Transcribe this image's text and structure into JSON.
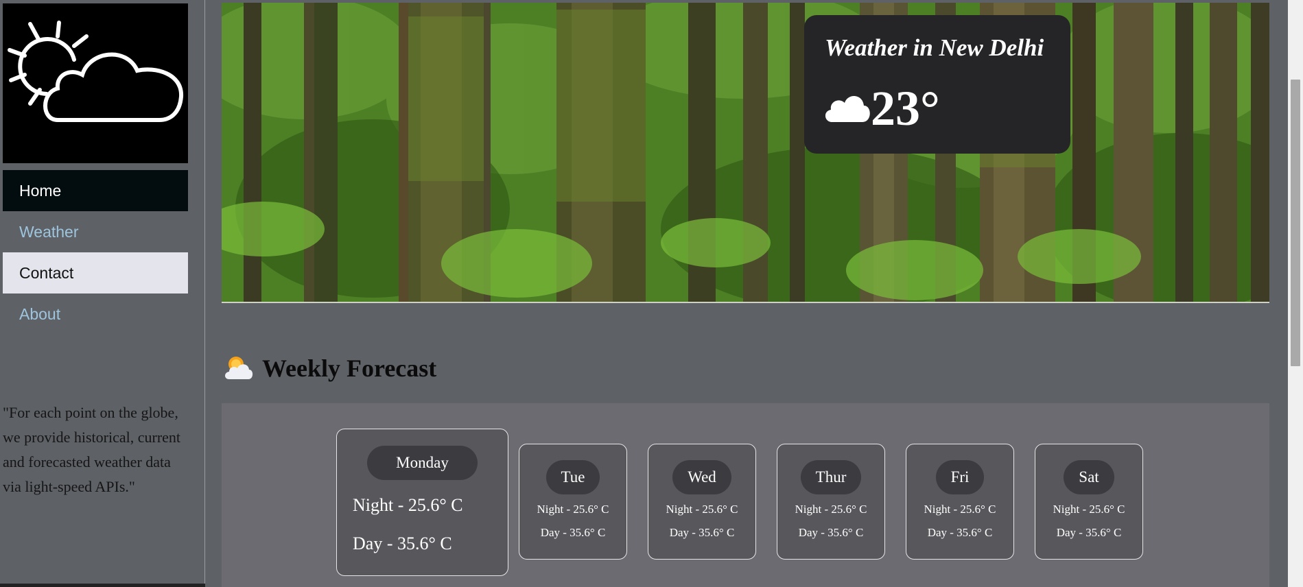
{
  "sidebar": {
    "logo_icon": "partly-cloudy-outline-icon",
    "nav": [
      {
        "label": "Home",
        "state": "active"
      },
      {
        "label": "Weather",
        "state": "link"
      },
      {
        "label": "Contact",
        "state": "highlighted"
      },
      {
        "label": "About",
        "state": "link"
      }
    ],
    "quote": "\"For each point on the globe, we provide historical, current and forecasted weather data via light-speed APIs.\""
  },
  "hero": {
    "background": "forest-photo",
    "card": {
      "title": "Weather in New Delhi",
      "icon": "cloud-icon",
      "temperature": "23°"
    }
  },
  "forecast": {
    "icon": "sun-behind-cloud-icon",
    "title": "Weekly Forecast",
    "days": [
      {
        "day": "Monday",
        "night": "Night - 25.6° C",
        "dayTemp": "Day - 35.6° C"
      },
      {
        "day": "Tue",
        "night": "Night - 25.6° C",
        "dayTemp": "Day - 35.6° C"
      },
      {
        "day": "Wed",
        "night": "Night - 25.6° C",
        "dayTemp": "Day - 35.6° C"
      },
      {
        "day": "Thur",
        "night": "Night - 25.6° C",
        "dayTemp": "Day - 35.6° C"
      },
      {
        "day": "Fri",
        "night": "Night - 25.6° C",
        "dayTemp": "Day - 35.6° C"
      },
      {
        "day": "Sat",
        "night": "Night - 25.6° C",
        "dayTemp": "Day - 35.6° C"
      }
    ]
  },
  "colors": {
    "page_bg": "#5e6166",
    "nav_active_bg": "#030d0f",
    "nav_link": "#9ec5dd",
    "nav_highlight_bg": "#e4e4ec",
    "card_bg": "#252427",
    "forecast_panel": "#6c6b71"
  }
}
